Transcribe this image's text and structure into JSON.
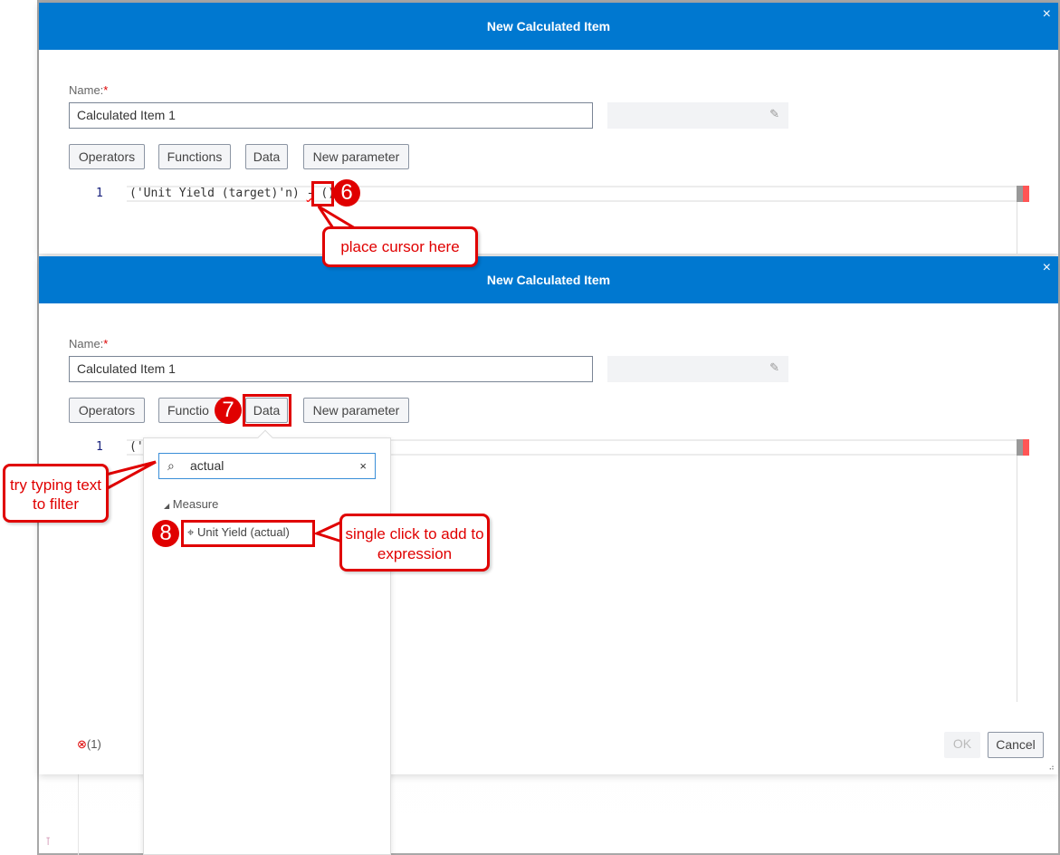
{
  "dialog1": {
    "title": "New Calculated Item",
    "close": "×",
    "name_label": "Name:",
    "required_mark": "*",
    "name_value": "Calculated Item 1",
    "buttons": {
      "operators": "Operators",
      "functions": "Functions",
      "data": "Data",
      "new_parameter": "New parameter"
    },
    "line_number": "1",
    "expression_a": "('Unit Yield (target)'n) ",
    "expression_op": "-",
    "expression_b": " ()"
  },
  "dialog2": {
    "title": "New Calculated Item",
    "close": "×",
    "name_label": "Name:",
    "required_mark": "*",
    "name_value": "Calculated Item 1",
    "buttons": {
      "operators": "Operators",
      "functions": "Functio",
      "data": "Data",
      "new_parameter": "New parameter"
    },
    "line_number": "1",
    "expression_visible": "('U",
    "error_count": "(1)",
    "ok": "OK",
    "cancel": "Cancel"
  },
  "data_panel": {
    "search_value": "actual",
    "clear": "×",
    "group": "Measure",
    "item": "Unit Yield (actual)"
  },
  "callouts": {
    "step6": "6",
    "step6_text": "place cursor here",
    "step7": "7",
    "step8": "8",
    "filter_text": "try typing text to filter",
    "add_text": "single click to add to expression"
  },
  "colors": {
    "header": "#0078d0",
    "callout": "#e00000"
  }
}
